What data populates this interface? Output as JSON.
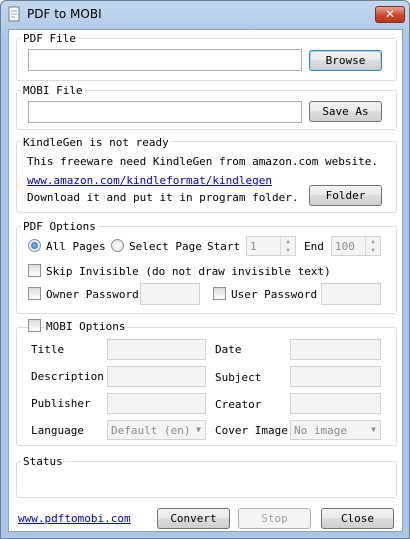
{
  "window": {
    "title": "PDF to MOBI",
    "close_label": "✕"
  },
  "pdf_file": {
    "label": "PDF File",
    "value": "",
    "browse_label": "Browse"
  },
  "mobi_file": {
    "label": "MOBI File",
    "value": "",
    "save_label": "Save As"
  },
  "kindlegen": {
    "label": "KindleGen is not ready",
    "line1": "This freeware need KindleGen from amazon.com website.",
    "link": "www.amazon.com/kindleformat/kindlegen",
    "line3": "Download it and put it in program folder.",
    "folder_label": "Folder"
  },
  "pdf_options": {
    "label": "PDF Options",
    "all_pages": "All Pages",
    "select_page": "Select Page",
    "start_label": "Start",
    "start_value": "1",
    "end_label": "End",
    "end_value": "100",
    "skip_invisible": "Skip Invisible (do not draw invisible text)",
    "owner_password": "Owner Password",
    "user_password": "User Password"
  },
  "mobi_options": {
    "label": "MOBI Options",
    "title": "Title",
    "date": "Date",
    "description": "Description",
    "subject": "Subject",
    "publisher": "Publisher",
    "creator": "Creator",
    "language": "Language",
    "language_value": "Default (en)",
    "cover_image": "Cover Image",
    "cover_value": "No image"
  },
  "status": {
    "label": "Status",
    "text": ""
  },
  "footer": {
    "link": "www.pdftomobi.com",
    "convert": "Convert",
    "stop": "Stop",
    "close": "Close"
  }
}
